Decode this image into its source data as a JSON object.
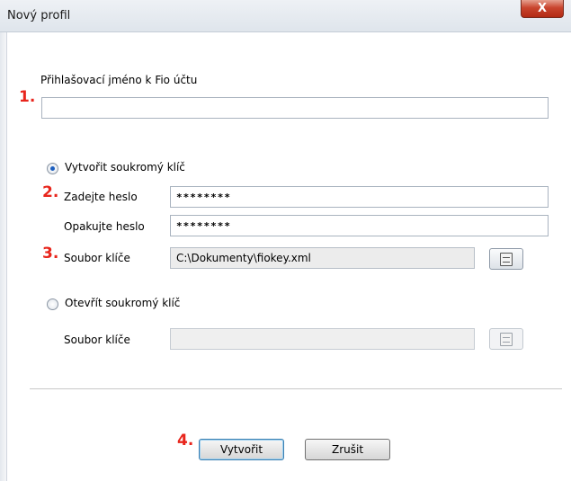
{
  "window": {
    "title": "Nový profil",
    "close_label": "X"
  },
  "markers": {
    "m1": "1.",
    "m2": "2.",
    "m3": "3.",
    "m4": "4."
  },
  "login": {
    "label": "Přihlašovací jméno k Fio účtu",
    "value": ""
  },
  "create_key": {
    "radio_label": "Vytvořit soukromý klíč",
    "selected": true,
    "password_label": "Zadejte heslo",
    "password_value": "********",
    "repeat_label": "Opakujte heslo",
    "repeat_value": "********",
    "file_label": "Soubor klíče",
    "file_value": "C:\\Dokumenty\\fiokey.xml"
  },
  "open_key": {
    "radio_label": "Otevřít soukromý klíč",
    "selected": false,
    "file_label": "Soubor klíče",
    "file_value": ""
  },
  "buttons": {
    "create": "Vytvořit",
    "cancel": "Zrušit"
  },
  "icons": {
    "browse": "file-cabinet-icon",
    "close": "close-icon"
  },
  "colors": {
    "marker_red": "#e8251c",
    "radio_selected": "#1d5fbf"
  }
}
